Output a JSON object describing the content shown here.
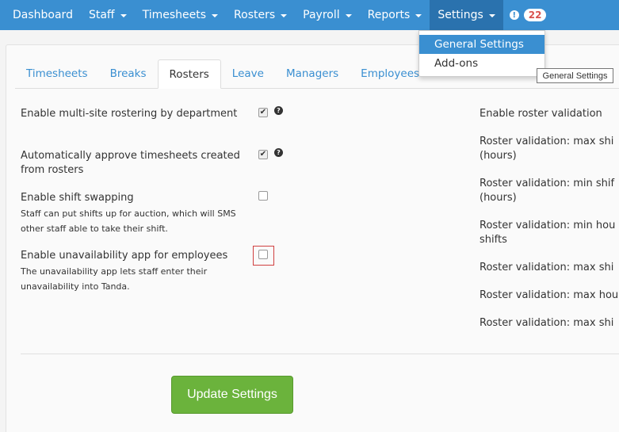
{
  "nav": {
    "items": [
      {
        "label": "Dashboard",
        "caret": false
      },
      {
        "label": "Staff",
        "caret": true
      },
      {
        "label": "Timesheets",
        "caret": true
      },
      {
        "label": "Rosters",
        "caret": true
      },
      {
        "label": "Payroll",
        "caret": true
      },
      {
        "label": "Reports",
        "caret": true
      },
      {
        "label": "Settings",
        "caret": true
      }
    ],
    "notifications_count": "22",
    "alert_icon": "!"
  },
  "tabs": [
    "Timesheets",
    "Breaks",
    "Rosters",
    "Leave",
    "Managers",
    "Employees"
  ],
  "active_tab": "Rosters",
  "left_settings": [
    {
      "label": "Enable multi-site rostering by department",
      "help": "",
      "checked": true,
      "has_help_icon": true
    },
    {
      "label": "Automatically approve timesheets created from rosters",
      "help": "",
      "checked": true,
      "has_help_icon": true
    },
    {
      "label": "Enable shift swapping",
      "help": "Staff can put shifts up for auction, which will SMS other staff able to take their shift.",
      "checked": false,
      "has_help_icon": false
    },
    {
      "label": "Enable unavailability app for employees",
      "help": "The unavailability app lets staff enter their unavailability into Tanda.",
      "checked": false,
      "has_help_icon": false
    }
  ],
  "right_settings": [
    "Enable roster validation",
    "Roster validation: max shi",
    "(hours)",
    "Roster validation: min shif",
    "(hours)",
    "Roster validation: min hou",
    "shifts",
    "Roster validation: max shi",
    "Roster validation: max hou",
    "Roster validation: max shi"
  ],
  "update_button": "Update Settings",
  "dropdown": {
    "items": [
      "General Settings",
      "Add-ons"
    ]
  },
  "tooltip": "General Settings",
  "help_icon_glyph": "?",
  "check_glyph": "✔",
  "colors": {
    "nav_bg": "#3a8fd1",
    "button_green": "#6bb33c",
    "badge_text": "#d9534f"
  }
}
